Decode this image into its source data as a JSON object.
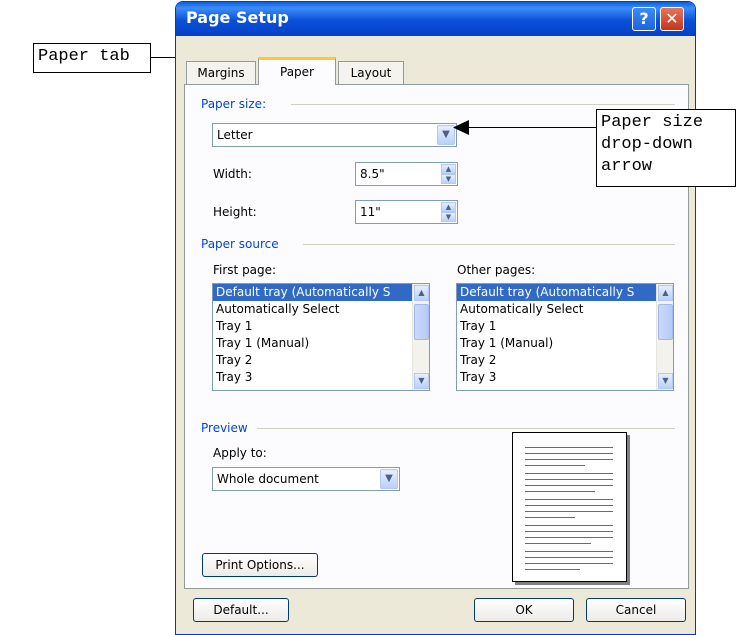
{
  "callouts": {
    "paper_tab": "Paper tab",
    "paper_size_arrow": [
      "Paper size",
      "drop-down",
      "arrow"
    ]
  },
  "dialog": {
    "title": "Page Setup",
    "help_glyph": "?",
    "close_glyph": "✕",
    "tabs": [
      {
        "label": "Margins",
        "active": false
      },
      {
        "label": "Paper",
        "active": true
      },
      {
        "label": "Layout",
        "active": false
      }
    ],
    "paper_size": {
      "group_label": "Paper size:",
      "selected": "Letter",
      "width_label": "Width:",
      "width_value": "8.5\"",
      "height_label": "Height:",
      "height_value": "11\""
    },
    "paper_source": {
      "group_label": "Paper source",
      "first_page_label": "First page:",
      "other_pages_label": "Other pages:",
      "first_page_items": [
        "Default tray (Automatically S",
        "Automatically Select",
        "Tray 1",
        "Tray 1 (Manual)",
        "Tray 2",
        "Tray 3"
      ],
      "other_pages_items": [
        "Default tray (Automatically S",
        "Automatically Select",
        "Tray 1",
        "Tray 1 (Manual)",
        "Tray 2",
        "Tray 3"
      ],
      "selected_index": 0
    },
    "preview": {
      "group_label": "Preview",
      "apply_to_label": "Apply to:",
      "apply_to_value": "Whole document"
    },
    "buttons": {
      "print_options": "Print Options...",
      "default": "Default...",
      "ok": "OK",
      "cancel": "Cancel"
    }
  },
  "colors": {
    "title_bar": "#0a50d8",
    "group_label": "#0046d5",
    "selection": "#316ac5",
    "active_tab_accent": "#ffc83c"
  },
  "icons": [
    "help-icon",
    "close-icon",
    "chevron-down-icon",
    "spin-up-icon",
    "spin-down-icon",
    "arrow-left-icon"
  ]
}
